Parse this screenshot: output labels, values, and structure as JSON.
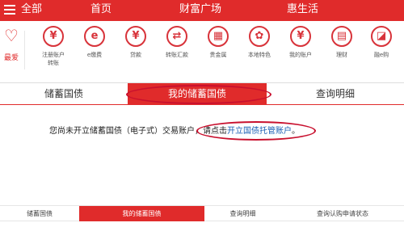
{
  "topnav": {
    "all": "全部",
    "home": "首页",
    "wealth": "财富广场",
    "life": "惠生活"
  },
  "favorites": {
    "label": "最爱"
  },
  "icons": [
    {
      "glyph": "¥",
      "label": "注册账户",
      "label2": "转账",
      "icon": "register-account-icon"
    },
    {
      "glyph": "e",
      "label": "e缴费",
      "icon": "e-payment-icon"
    },
    {
      "glyph": "¥",
      "label": "贷款",
      "icon": "loan-icon"
    },
    {
      "glyph": "⇄",
      "label": "转账汇款",
      "icon": "transfer-icon"
    },
    {
      "glyph": "▦",
      "label": "贵金属",
      "icon": "precious-metal-icon"
    },
    {
      "glyph": "✿",
      "label": "本地特色",
      "icon": "local-feature-icon"
    },
    {
      "glyph": "¥",
      "label": "我的账户",
      "icon": "my-account-icon"
    },
    {
      "glyph": "▤",
      "label": "理财",
      "icon": "finance-icon"
    },
    {
      "glyph": "◪",
      "label": "融e购",
      "icon": "e-shop-icon"
    }
  ],
  "tabs": {
    "savings_bonds": "储蓄国债",
    "my_savings_bonds": "我的储蓄国债",
    "query_details": "查询明细"
  },
  "message": {
    "text": "您尚未开立储蓄国债（电子式）交易账户，",
    "prompt": "请点击",
    "link": "开立国债托管账户",
    "end": "。"
  },
  "bottom_tabs": {
    "savings_bonds": "储蓄国债",
    "my_savings_bonds": "我的储蓄国债",
    "query_details": "查询明细",
    "query_subscription": "查询认购申请状态"
  },
  "colors": {
    "brand_red": "#e02b2b",
    "link_blue": "#1a5fb4",
    "annotation_red": "#c8102e"
  }
}
